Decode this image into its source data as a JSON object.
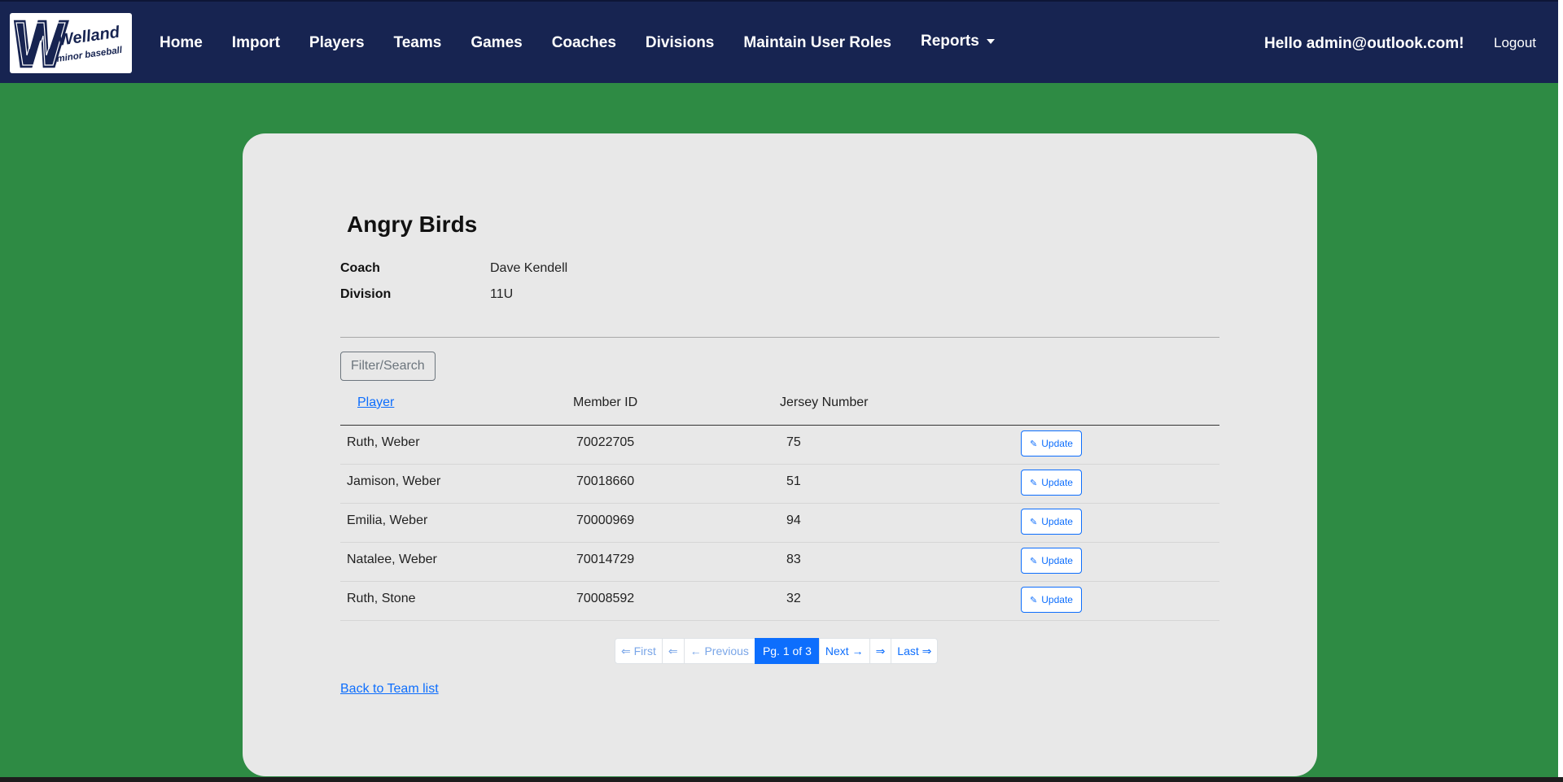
{
  "logo": {
    "line1": "Welland",
    "line2": "minor baseball"
  },
  "nav": {
    "links": [
      "Home",
      "Import",
      "Players",
      "Teams",
      "Games",
      "Coaches",
      "Divisions",
      "Maintain User Roles"
    ],
    "reports_label": "Reports",
    "greeting": "Hello admin@outlook.com!",
    "logout_label": "Logout"
  },
  "team": {
    "name": "Angry Birds",
    "coach_label": "Coach",
    "coach_value": "Dave Kendell",
    "division_label": "Division",
    "division_value": "11U"
  },
  "filter": {
    "label": "Filter/Search"
  },
  "table": {
    "headers": {
      "player": "Player",
      "member_id": "Member ID",
      "jersey": "Jersey Number"
    },
    "update_label": "Update",
    "rows": [
      {
        "player": "Ruth, Weber",
        "member_id": "70022705",
        "jersey": "75"
      },
      {
        "player": "Jamison, Weber",
        "member_id": "70018660",
        "jersey": "51"
      },
      {
        "player": "Emilia, Weber",
        "member_id": "70000969",
        "jersey": "94"
      },
      {
        "player": "Natalee, Weber",
        "member_id": "70014729",
        "jersey": "83"
      },
      {
        "player": "Ruth, Stone",
        "member_id": "70008592",
        "jersey": "32"
      }
    ]
  },
  "pager": {
    "first": "⇐ First",
    "prev_arrow": "⇐",
    "previous": "← Previous",
    "current": "Pg. 1 of 3",
    "next": "Next →",
    "next_arrow": "⇒",
    "last": "Last ⇒"
  },
  "back_link": "Back to Team list",
  "colors": {
    "navbar": "#172451",
    "background": "#2e8b44",
    "card": "#e8e8e8",
    "accent": "#0d6efd"
  }
}
